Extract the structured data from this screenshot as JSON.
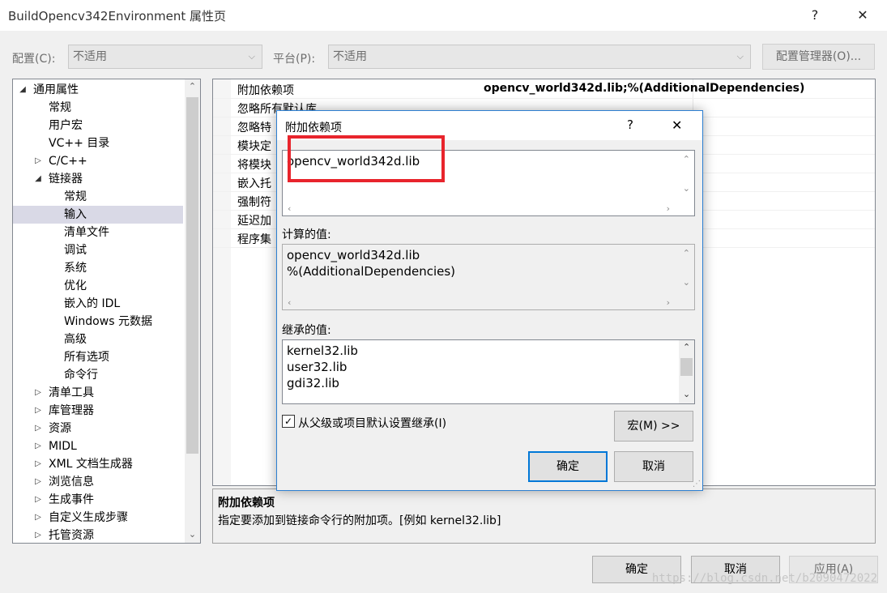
{
  "window": {
    "title": "BuildOpencv342Environment 属性页",
    "help_glyph": "?",
    "close_glyph": "✕"
  },
  "toolbar": {
    "config_label": "配置(C):",
    "config_value": "不适用",
    "platform_label": "平台(P):",
    "platform_value": "不适用",
    "config_manager": "配置管理器(O)..."
  },
  "tree": {
    "items": [
      {
        "label": "通用属性",
        "level": 0,
        "expander": "◢"
      },
      {
        "label": "常规",
        "level": 1,
        "expander": ""
      },
      {
        "label": "用户宏",
        "level": 1,
        "expander": ""
      },
      {
        "label": "VC++ 目录",
        "level": 1,
        "expander": ""
      },
      {
        "label": "C/C++",
        "level": 1,
        "expander": "▷"
      },
      {
        "label": "链接器",
        "level": 1,
        "expander": "◢"
      },
      {
        "label": "常规",
        "level": 2,
        "expander": ""
      },
      {
        "label": "输入",
        "level": 2,
        "expander": "",
        "selected": true
      },
      {
        "label": "清单文件",
        "level": 2,
        "expander": ""
      },
      {
        "label": "调试",
        "level": 2,
        "expander": ""
      },
      {
        "label": "系统",
        "level": 2,
        "expander": ""
      },
      {
        "label": "优化",
        "level": 2,
        "expander": ""
      },
      {
        "label": "嵌入的 IDL",
        "level": 2,
        "expander": ""
      },
      {
        "label": "Windows 元数据",
        "level": 2,
        "expander": ""
      },
      {
        "label": "高级",
        "level": 2,
        "expander": ""
      },
      {
        "label": "所有选项",
        "level": 2,
        "expander": ""
      },
      {
        "label": "命令行",
        "level": 2,
        "expander": ""
      },
      {
        "label": "清单工具",
        "level": 1,
        "expander": "▷"
      },
      {
        "label": "库管理器",
        "level": 1,
        "expander": "▷"
      },
      {
        "label": "资源",
        "level": 1,
        "expander": "▷"
      },
      {
        "label": "MIDL",
        "level": 1,
        "expander": "▷"
      },
      {
        "label": "XML 文档生成器",
        "level": 1,
        "expander": "▷"
      },
      {
        "label": "浏览信息",
        "level": 1,
        "expander": "▷"
      },
      {
        "label": "生成事件",
        "level": 1,
        "expander": "▷"
      },
      {
        "label": "自定义生成步骤",
        "level": 1,
        "expander": "▷"
      },
      {
        "label": "托管资源",
        "level": 1,
        "expander": "▷"
      }
    ]
  },
  "grid": {
    "first_key": "附加依赖项",
    "first_value": "opencv_world342d.lib;%(AdditionalDependencies)",
    "rows": [
      "忽略所有默认库",
      "忽略特",
      "模块定",
      "将模块",
      "嵌入托",
      "强制符",
      "延迟加",
      "程序集"
    ]
  },
  "description": {
    "title": "附加依赖项",
    "text": "指定要添加到链接命令行的附加项。[例如 kernel32.lib]"
  },
  "footer": {
    "ok": "确定",
    "cancel": "取消",
    "apply": "应用(A)"
  },
  "watermark": "https://blog.csdn.net/b2090472022",
  "dialog": {
    "title": "附加依赖项",
    "help_glyph": "?",
    "close_glyph": "✕",
    "edit_value": "opencv_world342d.lib",
    "computed_label": "计算的值:",
    "computed_lines": [
      "opencv_world342d.lib",
      "%(AdditionalDependencies)"
    ],
    "inherited_label": "继承的值:",
    "inherited_lines": [
      "kernel32.lib",
      "user32.lib",
      "gdi32.lib"
    ],
    "inherit_checkbox": "从父级或项目默认设置继承(I)",
    "inherit_checked": true,
    "macro_button": "宏(M) >>",
    "ok": "确定",
    "cancel": "取消"
  },
  "colors": {
    "accent": "#0078d7",
    "highlight_box": "#e8242c",
    "selected_row": "#d9d9e6"
  }
}
